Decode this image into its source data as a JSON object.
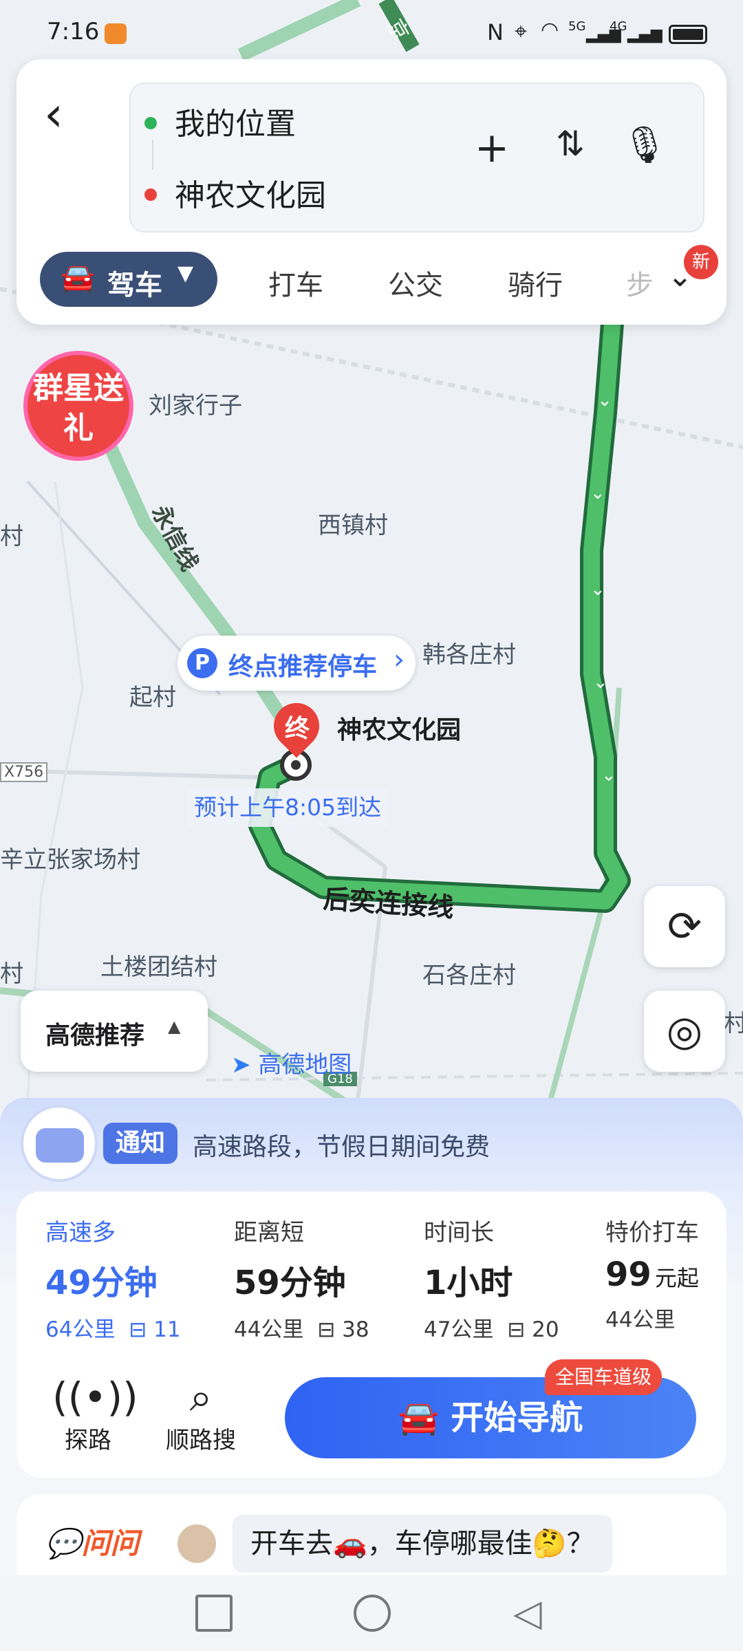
{
  "status_bar": {
    "time": "7:16",
    "signal_5g": "5G",
    "signal_4g": "4G"
  },
  "search": {
    "from": "我的位置",
    "to": "神农文化园",
    "from_color": "#2fb35a",
    "to_color": "#e8413b"
  },
  "modes": {
    "selected": "驾车",
    "items": [
      "打车",
      "公交",
      "骑行",
      "步"
    ],
    "new_badge": "新"
  },
  "map": {
    "places": [
      "刘家行子",
      "西镇村",
      "村",
      "韩各庄村",
      "起村",
      "X756",
      "辛立张家场村",
      "村",
      "土楼团结村",
      "石各庄村",
      "村"
    ],
    "roads": [
      "永信线",
      "后奕连接线",
      "京",
      "G18"
    ],
    "promo": "群星送礼",
    "parking_tip": "终点推荐停车",
    "parking_icon": "P",
    "pin_label": "终",
    "destination": "神农文化园",
    "eta": "预计上午8:05到达",
    "recommend": "高德推荐",
    "logo": "高德地图",
    "route_color": "#2f9a52",
    "alt_route_color": "#3f8b55"
  },
  "notice": {
    "tag": "通知",
    "text": "高速路段，节假日期间免费"
  },
  "routes": [
    {
      "title": "高速多",
      "time": "49分钟",
      "distance": "64公里",
      "lights": "11"
    },
    {
      "title": "距离短",
      "time": "59分钟",
      "distance": "44公里",
      "lights": "38"
    },
    {
      "title": "时间长",
      "time": "1小时",
      "distance": "47公里",
      "lights": "20"
    },
    {
      "title": "特价打车",
      "price": "99",
      "price_unit": "元起",
      "distance": "44公里"
    }
  ],
  "actions": {
    "explore": "探路",
    "search_along": "顺路搜",
    "start_nav": "开始导航",
    "lane_badge": "全国车道级"
  },
  "ask": {
    "label": "问问",
    "question": "开车去🚗，车停哪最佳🤔？"
  }
}
